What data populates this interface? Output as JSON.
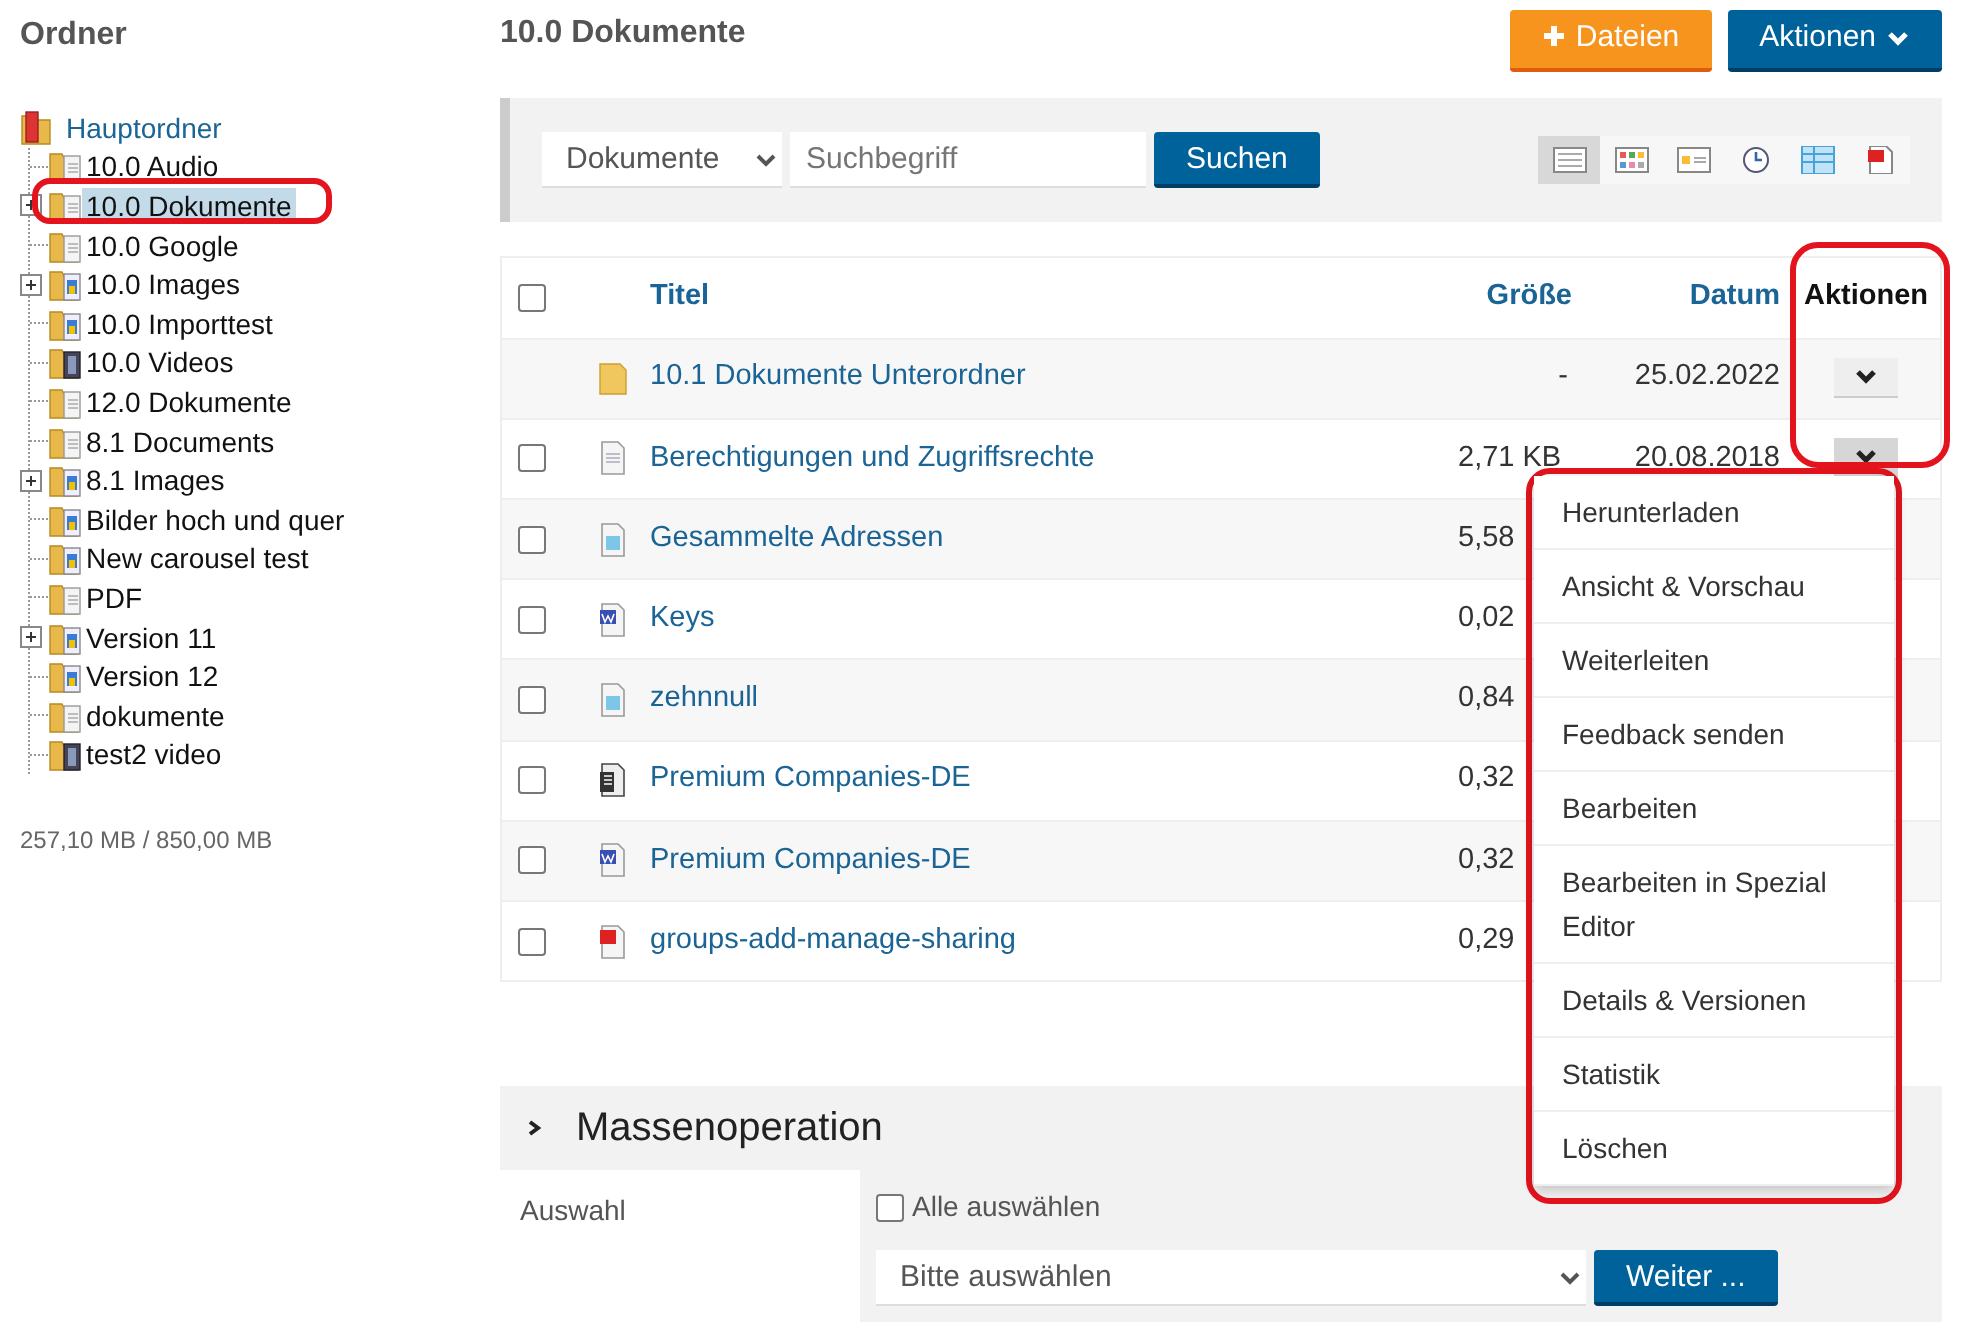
{
  "sidebar": {
    "title": "Ordner",
    "tree": {
      "label": "Hauptordner",
      "kind": "root",
      "children": [
        {
          "label": "10.0 Audio",
          "kind": "doc",
          "expandable": false,
          "selected": false,
          "circled": false
        },
        {
          "label": "10.0 Dokumente",
          "kind": "doc",
          "expandable": true,
          "selected": true,
          "circled": true
        },
        {
          "label": "10.0 Google",
          "kind": "doc",
          "expandable": false,
          "selected": false,
          "circled": false
        },
        {
          "label": "10.0 Images",
          "kind": "image",
          "expandable": true,
          "selected": false,
          "circled": false
        },
        {
          "label": "10.0 Importtest",
          "kind": "image",
          "expandable": false,
          "selected": false,
          "circled": false
        },
        {
          "label": "10.0 Videos",
          "kind": "video",
          "expandable": false,
          "selected": false,
          "circled": false
        },
        {
          "label": "12.0 Dokumente",
          "kind": "doc",
          "expandable": false,
          "selected": false,
          "circled": false
        },
        {
          "label": "8.1 Documents",
          "kind": "doc",
          "expandable": false,
          "selected": false,
          "circled": false
        },
        {
          "label": "8.1 Images",
          "kind": "image",
          "expandable": true,
          "selected": false,
          "circled": false
        },
        {
          "label": "Bilder hoch und quer",
          "kind": "image",
          "expandable": false,
          "selected": false,
          "circled": false
        },
        {
          "label": "New carousel test",
          "kind": "image",
          "expandable": false,
          "selected": false,
          "circled": false
        },
        {
          "label": "PDF",
          "kind": "doc",
          "expandable": false,
          "selected": false,
          "circled": false
        },
        {
          "label": "Version 11",
          "kind": "image",
          "expandable": true,
          "selected": false,
          "circled": false
        },
        {
          "label": "Version 12",
          "kind": "image",
          "expandable": false,
          "selected": false,
          "circled": false
        },
        {
          "label": "dokumente",
          "kind": "doc",
          "expandable": false,
          "selected": false,
          "circled": false
        },
        {
          "label": "test2 video",
          "kind": "video",
          "expandable": false,
          "selected": false,
          "circled": false
        }
      ]
    },
    "quota": "257,10 MB / 850,00 MB"
  },
  "header": {
    "title": "10.0 Dokumente",
    "add_button": "Dateien",
    "actions_button": "Aktionen"
  },
  "search": {
    "scope": "Dokumente",
    "placeholder": "Suchbegriff",
    "button": "Suchen",
    "views": [
      {
        "kind": "list",
        "selected": true
      },
      {
        "kind": "tiles",
        "selected": false
      },
      {
        "kind": "cards",
        "selected": false
      },
      {
        "kind": "timeline",
        "selected": false
      },
      {
        "kind": "table",
        "selected": false
      },
      {
        "kind": "pdf",
        "selected": false
      }
    ]
  },
  "table": {
    "select_all_checked": false,
    "columns": [
      "Titel",
      "Größe",
      "Datum",
      "Aktionen"
    ],
    "actions_circled": true,
    "rows": [
      {
        "kind": "folder",
        "title": "10.1 Dokumente Unterordner",
        "size": "-",
        "date": "25.02.2022",
        "menu_open": false
      },
      {
        "kind": "text",
        "title": "Berechtigungen und Zugriffsrechte",
        "size": "2,71 KB",
        "date": "20.08.2018",
        "checked": false,
        "menu_open": true
      },
      {
        "kind": "sheet",
        "title": "Gesammelte Adressen",
        "size": "5,58",
        "checked": false
      },
      {
        "kind": "word",
        "title": "Keys",
        "size": "0,02",
        "checked": false
      },
      {
        "kind": "sheet",
        "title": "zehnnull",
        "size": "0,84",
        "checked": false
      },
      {
        "kind": "archive",
        "title": "Premium Companies-DE",
        "size": "0,32",
        "checked": false
      },
      {
        "kind": "word",
        "title": "Premium Companies-DE",
        "size": "0,32",
        "checked": false
      },
      {
        "kind": "pdf",
        "title": "groups-add-manage-sharing",
        "size": "0,29",
        "checked": false
      }
    ]
  },
  "action_menu": {
    "circled": true,
    "items": [
      "Herunterladen",
      "Ansicht & Vorschau",
      "Weiterleiten",
      "Feedback senden",
      "Bearbeiten",
      "Bearbeiten in Spezial Editor",
      "Details & Versionen",
      "Statistik",
      "Löschen"
    ]
  },
  "bulk": {
    "title": "Massenoperation",
    "label": "Auswahl",
    "select_all": "Alle auswählen",
    "select_all_checked": false,
    "operation_placeholder": "Bitte auswählen",
    "button": "Weiter ..."
  }
}
